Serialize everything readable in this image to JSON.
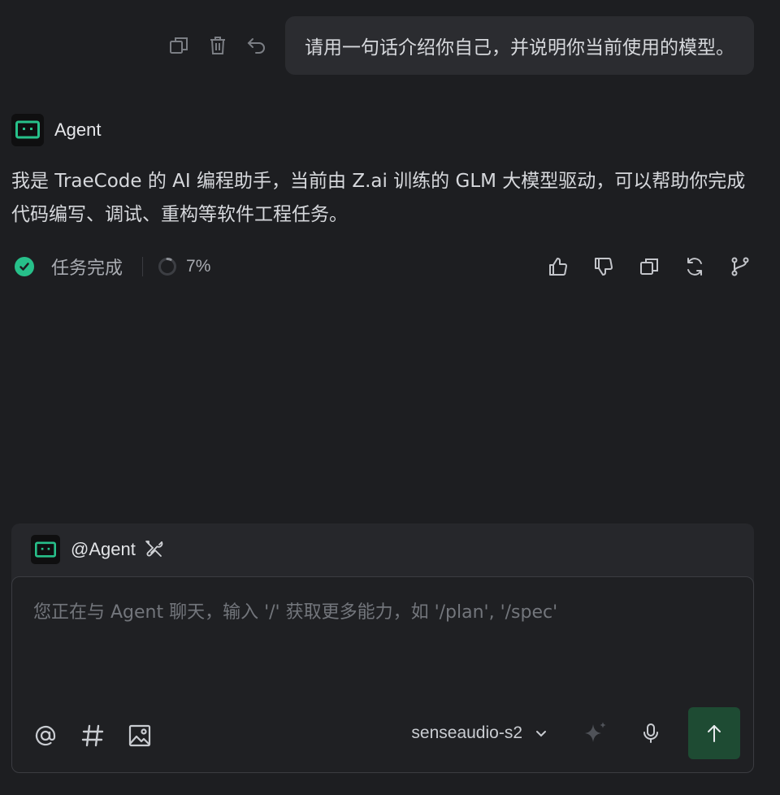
{
  "user_message": {
    "text": "请用一句话介绍你自己，并说明你当前使用的模型。",
    "actions": [
      "copy-icon",
      "trash-icon",
      "undo-icon"
    ]
  },
  "agent": {
    "name": "Agent",
    "response": "我是 TraeCode 的 AI 编程助手，当前由 Z.ai 训练的 GLM 大模型驱动，可以帮助你完成代码编写、调试、重构等软件工程任务。",
    "status_text": "任务完成",
    "progress_text": "7%",
    "progress_value": 0.07,
    "feedback_actions": [
      "thumbs-up-icon",
      "thumbs-down-icon",
      "copy-icon",
      "refresh-icon",
      "branch-icon"
    ]
  },
  "composer": {
    "mention": "@Agent",
    "placeholder": "您正在与 Agent 聊天，输入 '/' 获取更多能力，如 '/plan', '/spec'",
    "model": "senseaudio-s2",
    "tools": [
      "at-icon",
      "hash-icon",
      "image-icon"
    ]
  },
  "colors": {
    "background": "#1d1e21",
    "accent_green": "#27c08a",
    "send_button": "#1e4b33"
  }
}
